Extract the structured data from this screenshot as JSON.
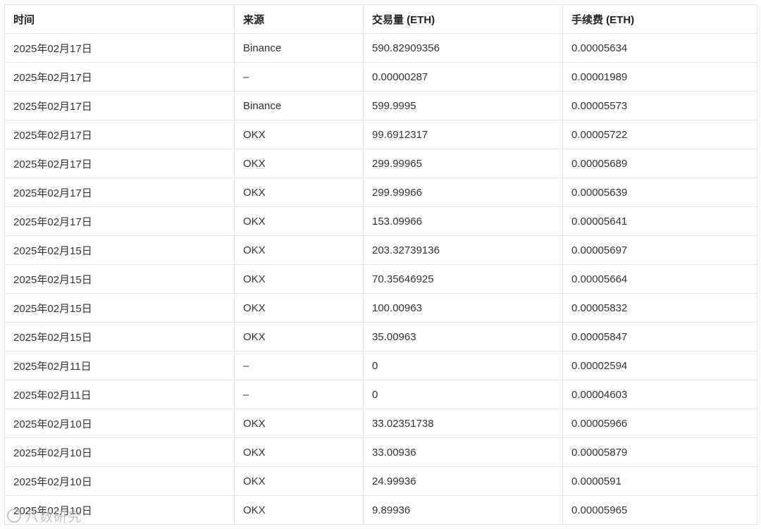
{
  "table": {
    "headers": [
      "时间",
      "来源",
      "交易量 (ETH)",
      "手续费 (ETH)"
    ],
    "rows": [
      [
        "2025年02月17日",
        "Binance",
        "590.82909356",
        "0.00005634"
      ],
      [
        "2025年02月17日",
        "–",
        "0.00000287",
        "0.00001989"
      ],
      [
        "2025年02月17日",
        "Binance",
        "599.9995",
        "0.00005573"
      ],
      [
        "2025年02月17日",
        "OKX",
        "99.6912317",
        "0.00005722"
      ],
      [
        "2025年02月17日",
        "OKX",
        "299.99965",
        "0.00005689"
      ],
      [
        "2025年02月17日",
        "OKX",
        "299.99966",
        "0.00005639"
      ],
      [
        "2025年02月17日",
        "OKX",
        "153.09966",
        "0.00005641"
      ],
      [
        "2025年02月15日",
        "OKX",
        "203.32739136",
        "0.00005697"
      ],
      [
        "2025年02月15日",
        "OKX",
        "70.35646925",
        "0.00005664"
      ],
      [
        "2025年02月15日",
        "OKX",
        "100.00963",
        "0.00005832"
      ],
      [
        "2025年02月15日",
        "OKX",
        "35.00963",
        "0.00005847"
      ],
      [
        "2025年02月11日",
        "–",
        "0",
        "0.00002594"
      ],
      [
        "2025年02月11日",
        "–",
        "0",
        "0.00004603"
      ],
      [
        "2025年02月10日",
        "OKX",
        "33.02351738",
        "0.00005966"
      ],
      [
        "2025年02月10日",
        "OKX",
        "33.00936",
        "0.00005879"
      ],
      [
        "2025年02月10日",
        "OKX",
        "24.99936",
        "0.0000591"
      ],
      [
        "2025年02月10日",
        "OKX",
        "9.89936",
        "0.00005965"
      ]
    ]
  },
  "watermark": {
    "text": "八数研究"
  }
}
